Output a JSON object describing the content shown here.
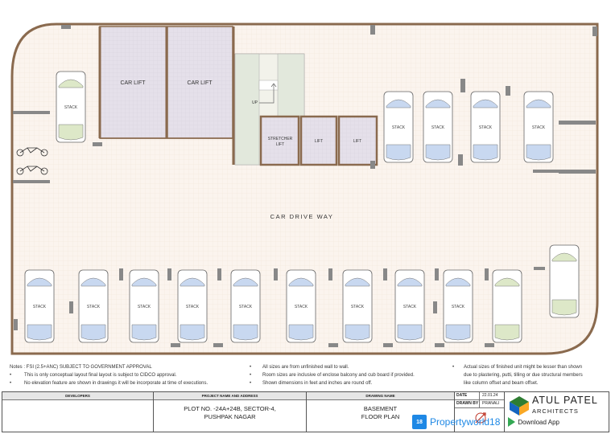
{
  "labels": {
    "car_lift_1": "CAR LIFT",
    "car_lift_2": "CAR LIFT",
    "up": "UP",
    "stretcher_lift_l1": "STRETCHER",
    "stretcher_lift_l2": "LIFT",
    "lift_1": "LIFT",
    "lift_2": "LIFT",
    "drive_way": "CAR DRIVE WAY",
    "stack": "STACK"
  },
  "notes": {
    "left": [
      "Notes : FSI (2.5+ANC) SUBJECT TO GOVERNMENT APPROVAL",
      "This is only conceptual layout final layout is subject to CIDCO approval.",
      "No elevation feature are shown in drawings it will be incorporate at time of executions."
    ],
    "middle": [
      "All sizes are from unfinished wall to wall.",
      "Room sizes are inclusive of enclose balcony and cub board if provided.",
      "Shown dimensions in feet and inches are round off."
    ],
    "right": [
      "Actual sizes of finished unit might be lesser than shown",
      "due to plastering, putti, tilling or due structural members",
      "like column offset and beam offset."
    ]
  },
  "title_block": {
    "developers_label": "DEVELOPERS",
    "project_label": "PROJECT NAME AND ADDRESS",
    "project_line1": "PLOT NO. -24A+24B, SECTOR-4,",
    "project_line2": "PUSHPAK NAGAR",
    "drawing_label": "DRAWING NAME",
    "drawing_line1": "BASEMENT",
    "drawing_line2": "FLOOR PLAN",
    "date_label": "DATE",
    "date_value": "22.01.24",
    "drawn_by_label": "DRAWN BY",
    "drawn_by_value": "PRANALI",
    "firm_name": "ATUL PATEL",
    "firm_sub": "ARCHITECTS"
  },
  "watermark": {
    "badge": "18",
    "site": "Propertyworld18",
    "download": "Download App"
  },
  "colors": {
    "wall": "#8a6a4e",
    "floor": "#fbf4ee",
    "lift_fill": "#e5e0ea",
    "car_body": "#ffffff",
    "car_glass": "#c8d8f0",
    "car_glass_alt": "#dde8c8",
    "watermark_blue": "#1e88e5"
  }
}
